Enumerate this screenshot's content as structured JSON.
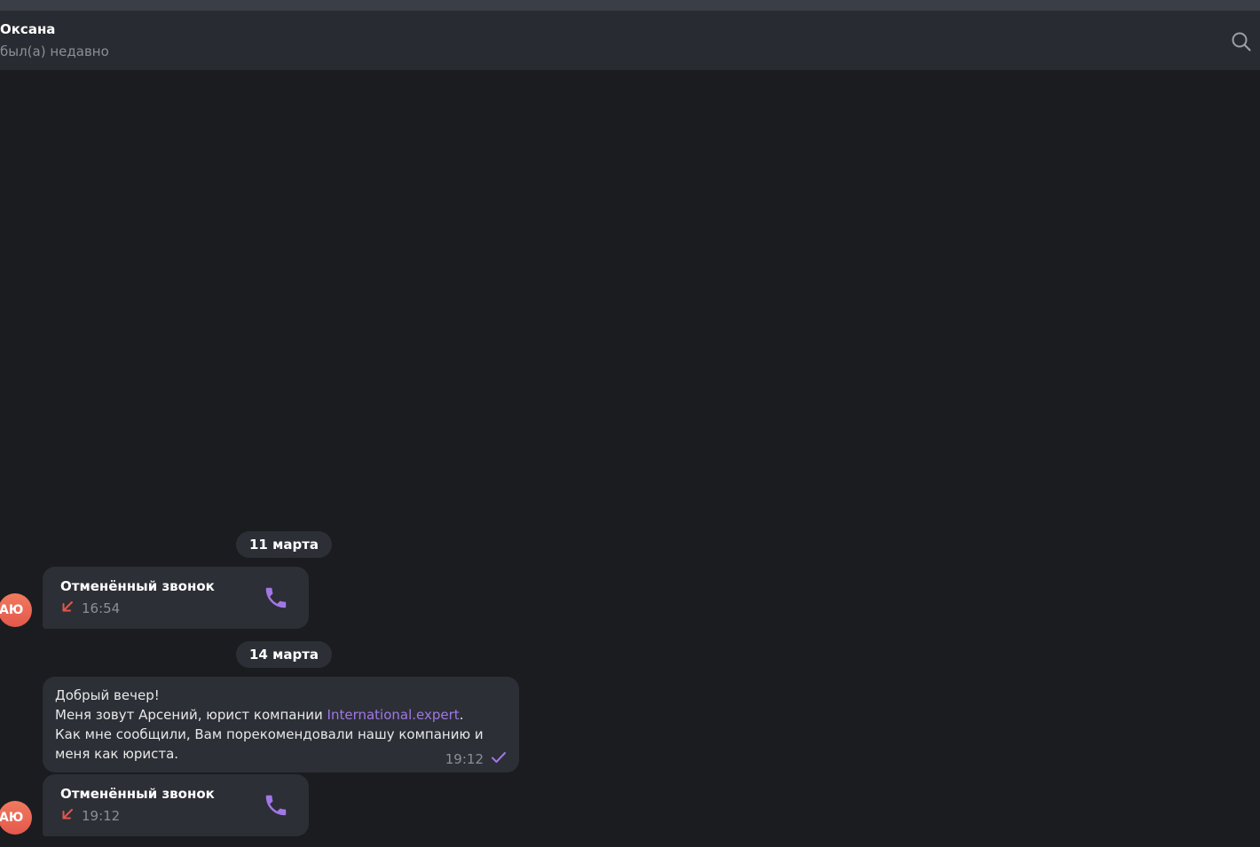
{
  "chat": {
    "contact_name": "Оксана",
    "contact_status": "был(а) недавно",
    "icons": {
      "search": "search-icon",
      "call": "phone-icon",
      "missed": "arrow-down-left-icon",
      "read": "check-icon"
    }
  },
  "colors": {
    "accent": "#a177e6",
    "missed": "#e0574c",
    "avatar": "#e4584c"
  },
  "messages": {
    "date1": "11 марта",
    "call1": {
      "title": "Отменённый звонок",
      "time": "16:54",
      "avatar": "АЮ"
    },
    "date2": "14 марта",
    "text1": {
      "line1": "Добрый вечер!",
      "line2_pre": "Меня зовут Арсений, юрист компании ",
      "line2_link": "International.expert",
      "line2_post": ".",
      "line3": "Как мне сообщили, Вам порекомендовали нашу компанию и",
      "line4": "меня как юриста.",
      "time": "19:12"
    },
    "call2": {
      "title": "Отменённый звонок",
      "time": "19:12",
      "avatar": "АЮ"
    }
  }
}
